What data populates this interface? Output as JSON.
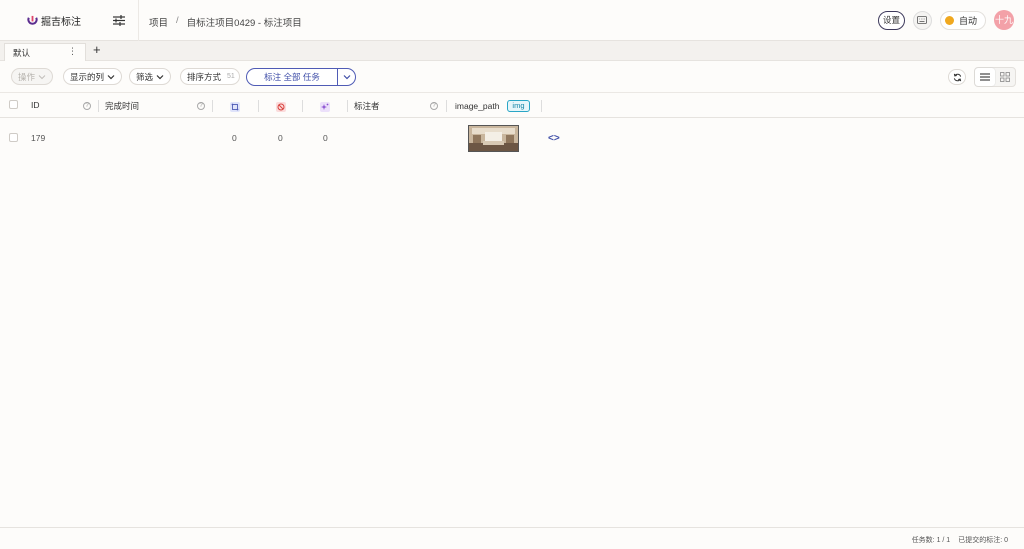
{
  "header": {
    "app_name": "掘吉标注",
    "breadcrumb": [
      "项目",
      "自标注项目0429 - 标注项目"
    ],
    "breadcrumb_sep": "/",
    "settings_label": "设置",
    "auto_label": "自动",
    "avatar_text": "十九"
  },
  "tabs": [
    {
      "label": "默认",
      "menu": "⋮"
    }
  ],
  "add_tab": "+",
  "toolbar": {
    "actions_label": "操作",
    "columns_label": "显示的列",
    "filter_label": "筛选",
    "sort_label": "排序方式",
    "sort_badge": "51",
    "label_all": "标注 全部 任务"
  },
  "table": {
    "columns": {
      "id": "ID",
      "completed": "完成时间",
      "annotator": "标注者",
      "image_path": "image_path",
      "img_badge": "img"
    },
    "rows": [
      {
        "id": "179",
        "c1": "0",
        "c2": "0",
        "c3": "0"
      }
    ]
  },
  "footer": {
    "tasks": "任务数: 1 / 1",
    "submitted": "已提交的标注: 0"
  },
  "colors": {
    "accent": "#3f4ea8",
    "auto_dot": "#f0a81f",
    "avatar": "#f3a1a8",
    "img_badge": "#2aa6c6"
  }
}
